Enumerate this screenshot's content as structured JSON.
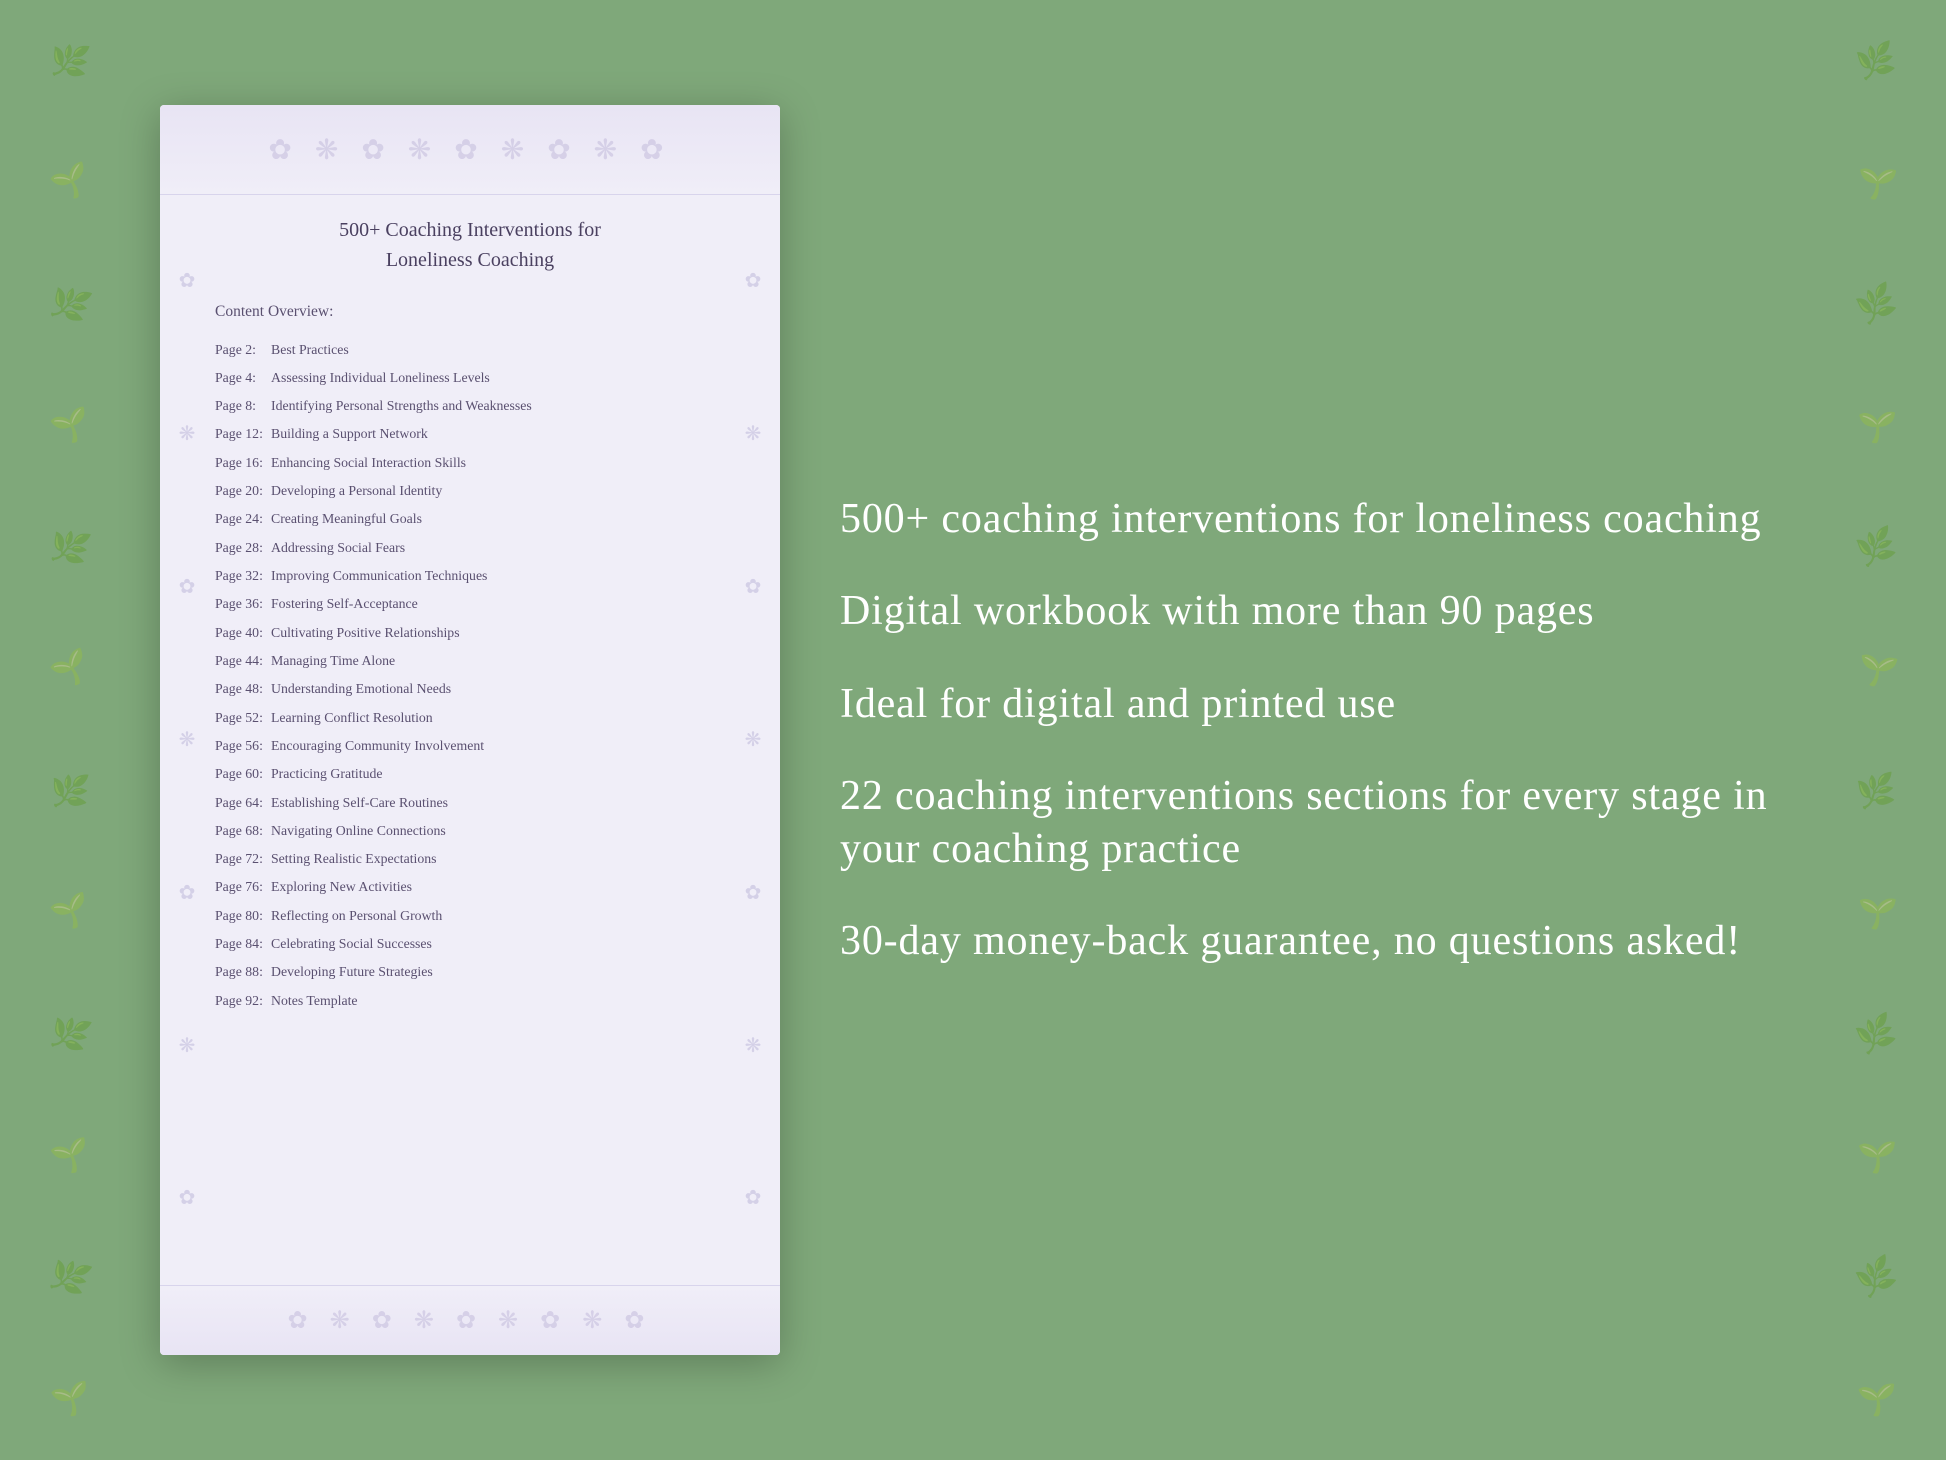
{
  "background": {
    "color": "#7fa87a"
  },
  "document": {
    "title_line1": "500+ Coaching Interventions for",
    "title_line2": "Loneliness Coaching",
    "section_label": "Content Overview:",
    "toc": [
      {
        "page": "Page  2:",
        "title": "Best Practices"
      },
      {
        "page": "Page  4:",
        "title": "Assessing Individual Loneliness Levels"
      },
      {
        "page": "Page  8:",
        "title": "Identifying Personal Strengths and Weaknesses"
      },
      {
        "page": "Page 12:",
        "title": "Building a Support Network"
      },
      {
        "page": "Page 16:",
        "title": "Enhancing Social Interaction Skills"
      },
      {
        "page": "Page 20:",
        "title": "Developing a Personal Identity"
      },
      {
        "page": "Page 24:",
        "title": "Creating Meaningful Goals"
      },
      {
        "page": "Page 28:",
        "title": "Addressing Social Fears"
      },
      {
        "page": "Page 32:",
        "title": "Improving Communication Techniques"
      },
      {
        "page": "Page 36:",
        "title": "Fostering Self-Acceptance"
      },
      {
        "page": "Page 40:",
        "title": "Cultivating Positive Relationships"
      },
      {
        "page": "Page 44:",
        "title": "Managing Time Alone"
      },
      {
        "page": "Page 48:",
        "title": "Understanding Emotional Needs"
      },
      {
        "page": "Page 52:",
        "title": "Learning Conflict Resolution"
      },
      {
        "page": "Page 56:",
        "title": "Encouraging Community Involvement"
      },
      {
        "page": "Page 60:",
        "title": "Practicing Gratitude"
      },
      {
        "page": "Page 64:",
        "title": "Establishing Self-Care Routines"
      },
      {
        "page": "Page 68:",
        "title": "Navigating Online Connections"
      },
      {
        "page": "Page 72:",
        "title": "Setting Realistic Expectations"
      },
      {
        "page": "Page 76:",
        "title": "Exploring New Activities"
      },
      {
        "page": "Page 80:",
        "title": "Reflecting on Personal Growth"
      },
      {
        "page": "Page 84:",
        "title": "Celebrating Social Successes"
      },
      {
        "page": "Page 88:",
        "title": "Developing Future Strategies"
      },
      {
        "page": "Page 92:",
        "title": "Notes Template"
      }
    ]
  },
  "features": [
    {
      "id": "feature-1",
      "text": "500+ coaching interventions for loneliness coaching"
    },
    {
      "id": "feature-2",
      "text": "Digital workbook with more than 90 pages"
    },
    {
      "id": "feature-3",
      "text": "Ideal for digital and printed use"
    },
    {
      "id": "feature-4",
      "text": "22 coaching interventions sections for every stage in your coaching practice"
    },
    {
      "id": "feature-5",
      "text": "30-day money-back guarantee, no questions asked!"
    }
  ],
  "leaf_sprigs": [
    "🌿",
    "🌱",
    "🌿",
    "🌱",
    "🌿",
    "🌱",
    "🌿",
    "🌱",
    "🌿",
    "🌱",
    "🌿",
    "🌱"
  ]
}
